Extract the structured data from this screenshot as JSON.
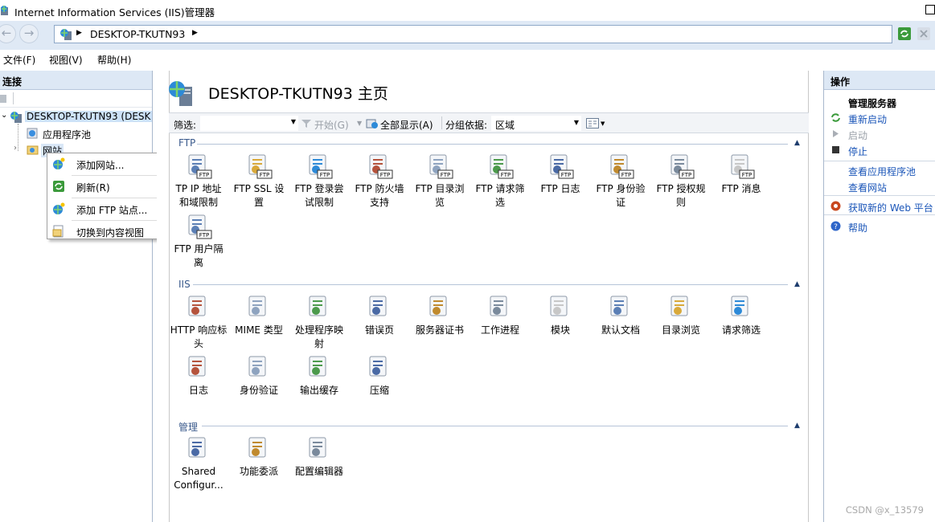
{
  "window": {
    "title": "Internet Information Services (IIS)管理器"
  },
  "address": {
    "path": "DESKTOP-TKUTN93"
  },
  "menu": [
    {
      "label": "文件(F)"
    },
    {
      "label": "视图(V)"
    },
    {
      "label": "帮助(H)"
    }
  ],
  "connections": {
    "header": "连接",
    "tree": [
      {
        "label": "DESKTOP-TKUTN93 (DESK",
        "selected": true
      },
      {
        "label": "应用程序池"
      },
      {
        "label": "网站"
      }
    ]
  },
  "context_menu": [
    {
      "label": "添加网站..."
    },
    {
      "label": "刷新(R)"
    },
    {
      "label": "添加 FTP 站点..."
    },
    {
      "label": "切换到内容视图"
    }
  ],
  "main": {
    "title": "DESKTOP-TKUTN93 主页",
    "filter": {
      "label": "筛选:",
      "start": "开始(G)",
      "show_all": "全部显示(A)",
      "group_label": "分组依据:",
      "group_value": "区域"
    },
    "groups": [
      {
        "name": "FTP",
        "items": [
          {
            "label": "FTP IP 地址和域限制",
            "l1": "TP IP 地址",
            "l2": "和域限制",
            "icon": "ftp-ip-restrictions-icon"
          },
          {
            "label": "FTP SSL 设置",
            "l1": "FTP SSL 设",
            "l2": "置",
            "icon": "ftp-ssl-icon"
          },
          {
            "label": "FTP 登录尝试限制",
            "l1": "FTP 登录尝",
            "l2": "试限制",
            "icon": "ftp-logon-attempt-icon"
          },
          {
            "label": "FTP 防火墙支持",
            "l1": "FTP 防火墙",
            "l2": "支持",
            "icon": "ftp-firewall-icon"
          },
          {
            "label": "FTP 目录浏览",
            "l1": "FTP 目录浏",
            "l2": "览",
            "icon": "ftp-directory-browsing-icon"
          },
          {
            "label": "FTP 请求筛选",
            "l1": "FTP 请求筛",
            "l2": "选",
            "icon": "ftp-request-filtering-icon"
          },
          {
            "label": "FTP 日志",
            "l1": "FTP 日志",
            "l2": "",
            "icon": "ftp-logging-icon"
          },
          {
            "label": "FTP 身份验证",
            "l1": "FTP 身份验",
            "l2": "证",
            "icon": "ftp-authentication-icon"
          },
          {
            "label": "FTP 授权规则",
            "l1": "FTP 授权规",
            "l2": "则",
            "icon": "ftp-authorization-icon"
          },
          {
            "label": "FTP 消息",
            "l1": "FTP 消息",
            "l2": "",
            "icon": "ftp-messages-icon"
          },
          {
            "label": "FTP 用户隔离",
            "l1": "FTP 用户隔",
            "l2": "离",
            "icon": "ftp-user-isolation-icon"
          }
        ]
      },
      {
        "name": "IIS",
        "items": [
          {
            "label": "HTTP 响应标头",
            "l1": "HTTP 响应标",
            "l2": "头",
            "icon": "http-headers-icon"
          },
          {
            "label": "MIME 类型",
            "l1": "MIME 类型",
            "l2": "",
            "icon": "mime-types-icon"
          },
          {
            "label": "处理程序映射",
            "l1": "处理程序映",
            "l2": "射",
            "icon": "handler-mappings-icon"
          },
          {
            "label": "错误页",
            "l1": "错误页",
            "l2": "",
            "icon": "error-pages-icon"
          },
          {
            "label": "服务器证书",
            "l1": "服务器证书",
            "l2": "",
            "icon": "server-certificates-icon"
          },
          {
            "label": "工作进程",
            "l1": "工作进程",
            "l2": "",
            "icon": "worker-processes-icon"
          },
          {
            "label": "模块",
            "l1": "模块",
            "l2": "",
            "icon": "modules-icon"
          },
          {
            "label": "默认文档",
            "l1": "默认文档",
            "l2": "",
            "icon": "default-document-icon"
          },
          {
            "label": "目录浏览",
            "l1": "目录浏览",
            "l2": "",
            "icon": "directory-browsing-icon"
          },
          {
            "label": "请求筛选",
            "l1": "请求筛选",
            "l2": "",
            "icon": "request-filtering-icon"
          },
          {
            "label": "日志",
            "l1": "日志",
            "l2": "",
            "icon": "logging-icon"
          },
          {
            "label": "身份验证",
            "l1": "身份验证",
            "l2": "",
            "icon": "authentication-icon"
          },
          {
            "label": "输出缓存",
            "l1": "输出缓存",
            "l2": "",
            "icon": "output-caching-icon"
          },
          {
            "label": "压缩",
            "l1": "压缩",
            "l2": "",
            "icon": "compression-icon"
          }
        ]
      },
      {
        "name": "管理",
        "items": [
          {
            "label": "Shared Configur...",
            "l1": "Shared",
            "l2": "Configur...",
            "icon": "shared-configuration-icon"
          },
          {
            "label": "功能委派",
            "l1": "功能委派",
            "l2": "",
            "icon": "feature-delegation-icon"
          },
          {
            "label": "配置编辑器",
            "l1": "配置编辑器",
            "l2": "",
            "icon": "configuration-editor-icon"
          }
        ]
      }
    ]
  },
  "actions": {
    "header": "操作",
    "section": "管理服务器",
    "items": [
      {
        "label": "重新启动",
        "enabled": true
      },
      {
        "label": "启动",
        "enabled": false
      },
      {
        "label": "停止",
        "enabled": true
      }
    ],
    "links": [
      {
        "label": "查看应用程序池"
      },
      {
        "label": "查看网站"
      }
    ],
    "web_platform": "获取新的 Web 平台",
    "help": "帮助"
  },
  "watermark": "CSDN @x_13579"
}
